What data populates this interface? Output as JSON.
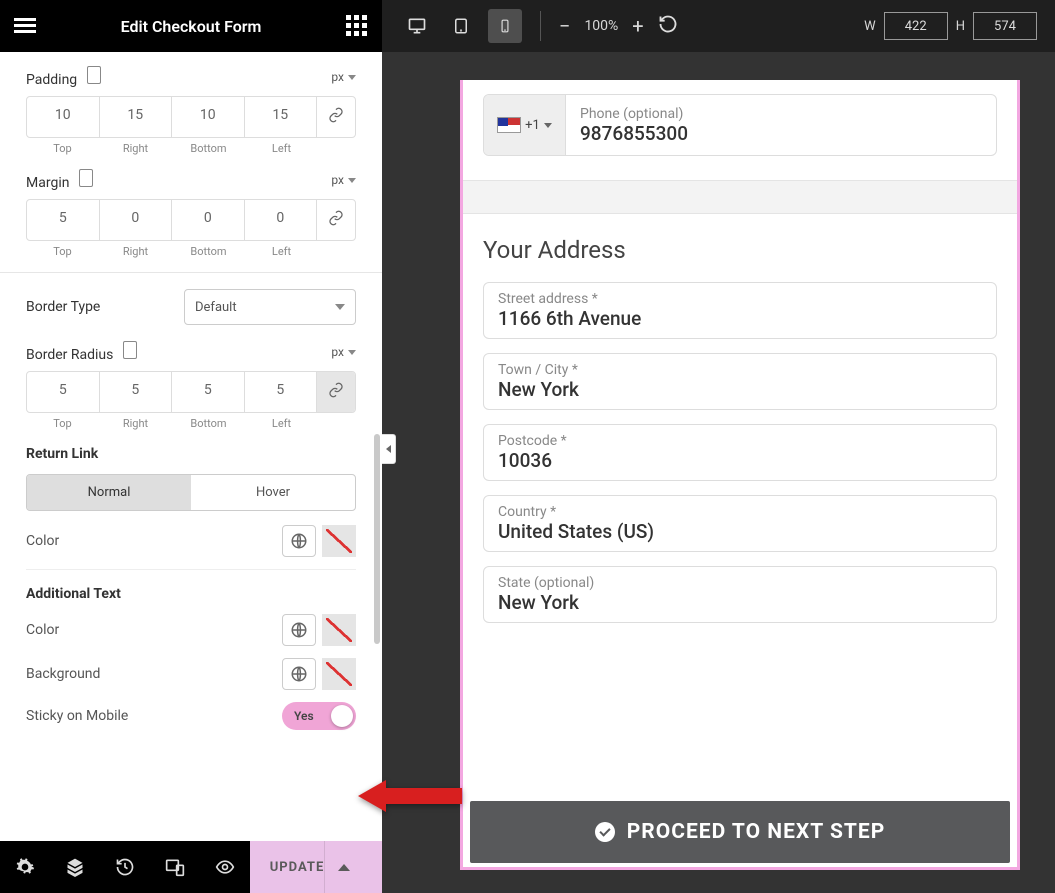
{
  "header": {
    "title": "Edit Checkout Form"
  },
  "padding": {
    "label": "Padding",
    "unit": "px",
    "top": "10",
    "right": "15",
    "bottom": "10",
    "left": "15",
    "sides": {
      "t": "Top",
      "r": "Right",
      "b": "Bottom",
      "l": "Left"
    }
  },
  "margin": {
    "label": "Margin",
    "unit": "px",
    "top": "5",
    "right": "0",
    "bottom": "0",
    "left": "0"
  },
  "border_type": {
    "label": "Border Type",
    "value": "Default"
  },
  "border_radius": {
    "label": "Border Radius",
    "unit": "px",
    "top": "5",
    "right": "5",
    "bottom": "5",
    "left": "5"
  },
  "return_link": {
    "heading": "Return Link",
    "tabs": {
      "normal": "Normal",
      "hover": "Hover"
    },
    "color_label": "Color"
  },
  "additional_text": {
    "heading": "Additional Text",
    "color_label": "Color",
    "bg_label": "Background",
    "sticky_label": "Sticky on Mobile",
    "sticky_value": "Yes"
  },
  "footer": {
    "update": "UPDATE"
  },
  "topbar": {
    "zoom": "100%",
    "w_label": "W",
    "w_value": "422",
    "h_label": "H",
    "h_value": "574"
  },
  "preview": {
    "phone_label": "Phone (optional)",
    "phone_value": "9876855300",
    "phone_code": "+1",
    "address_title": "Your Address",
    "street_label": "Street address *",
    "street_value": "1166 6th Avenue",
    "city_label": "Town / City *",
    "city_value": "New York",
    "postcode_label": "Postcode *",
    "postcode_value": "10036",
    "country_label": "Country *",
    "country_value": "United States (US)",
    "state_label": "State (optional)",
    "state_value": "New York",
    "proceed": "PROCEED TO NEXT STEP"
  }
}
